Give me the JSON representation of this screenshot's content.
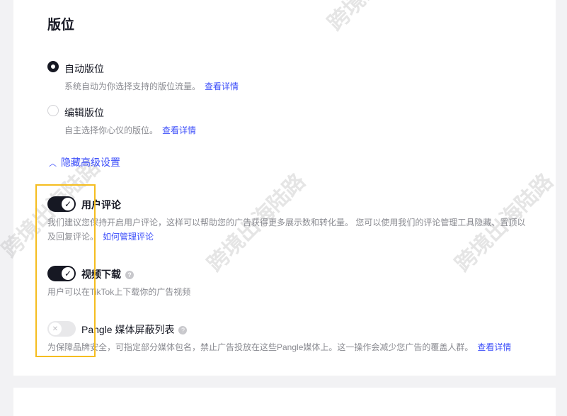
{
  "section_title": "版位",
  "placement": {
    "options": [
      {
        "label": "自动版位",
        "selected": true,
        "description": "系统自动为你选择支持的版位流量。",
        "link": "查看详情"
      },
      {
        "label": "编辑版位",
        "selected": false,
        "description": "自主选择你心仪的版位。",
        "link": "查看详情"
      }
    ],
    "advanced_toggle": "隐藏高级设置"
  },
  "settings": [
    {
      "label": "用户评论",
      "enabled": true,
      "description_line1": "我们建议您保持开启用户评论，这样可以帮助您的广告获得更多展示数和转化量。 您可以使用我们的评论管理工具隐藏、置顶以",
      "description_line2": "及回复评论。",
      "link": "如何管理评论"
    },
    {
      "label": "视频下载",
      "enabled": true,
      "help": "?",
      "description": "用户可以在TikTok上下载你的广告视频"
    },
    {
      "label": "Pangle 媒体屏蔽列表",
      "enabled": false,
      "help": "?",
      "description": "为保障品牌安全，可指定部分媒体包名，禁止广告投放在这些Pangle媒体上。这一操作会减少您广告的覆盖人群。",
      "link": "查看详情"
    }
  ],
  "watermark": "跨境出海陆路",
  "colors": {
    "accent": "#3b4dfa",
    "highlight": "#f5bd1f",
    "toggle_on": "#161823"
  }
}
